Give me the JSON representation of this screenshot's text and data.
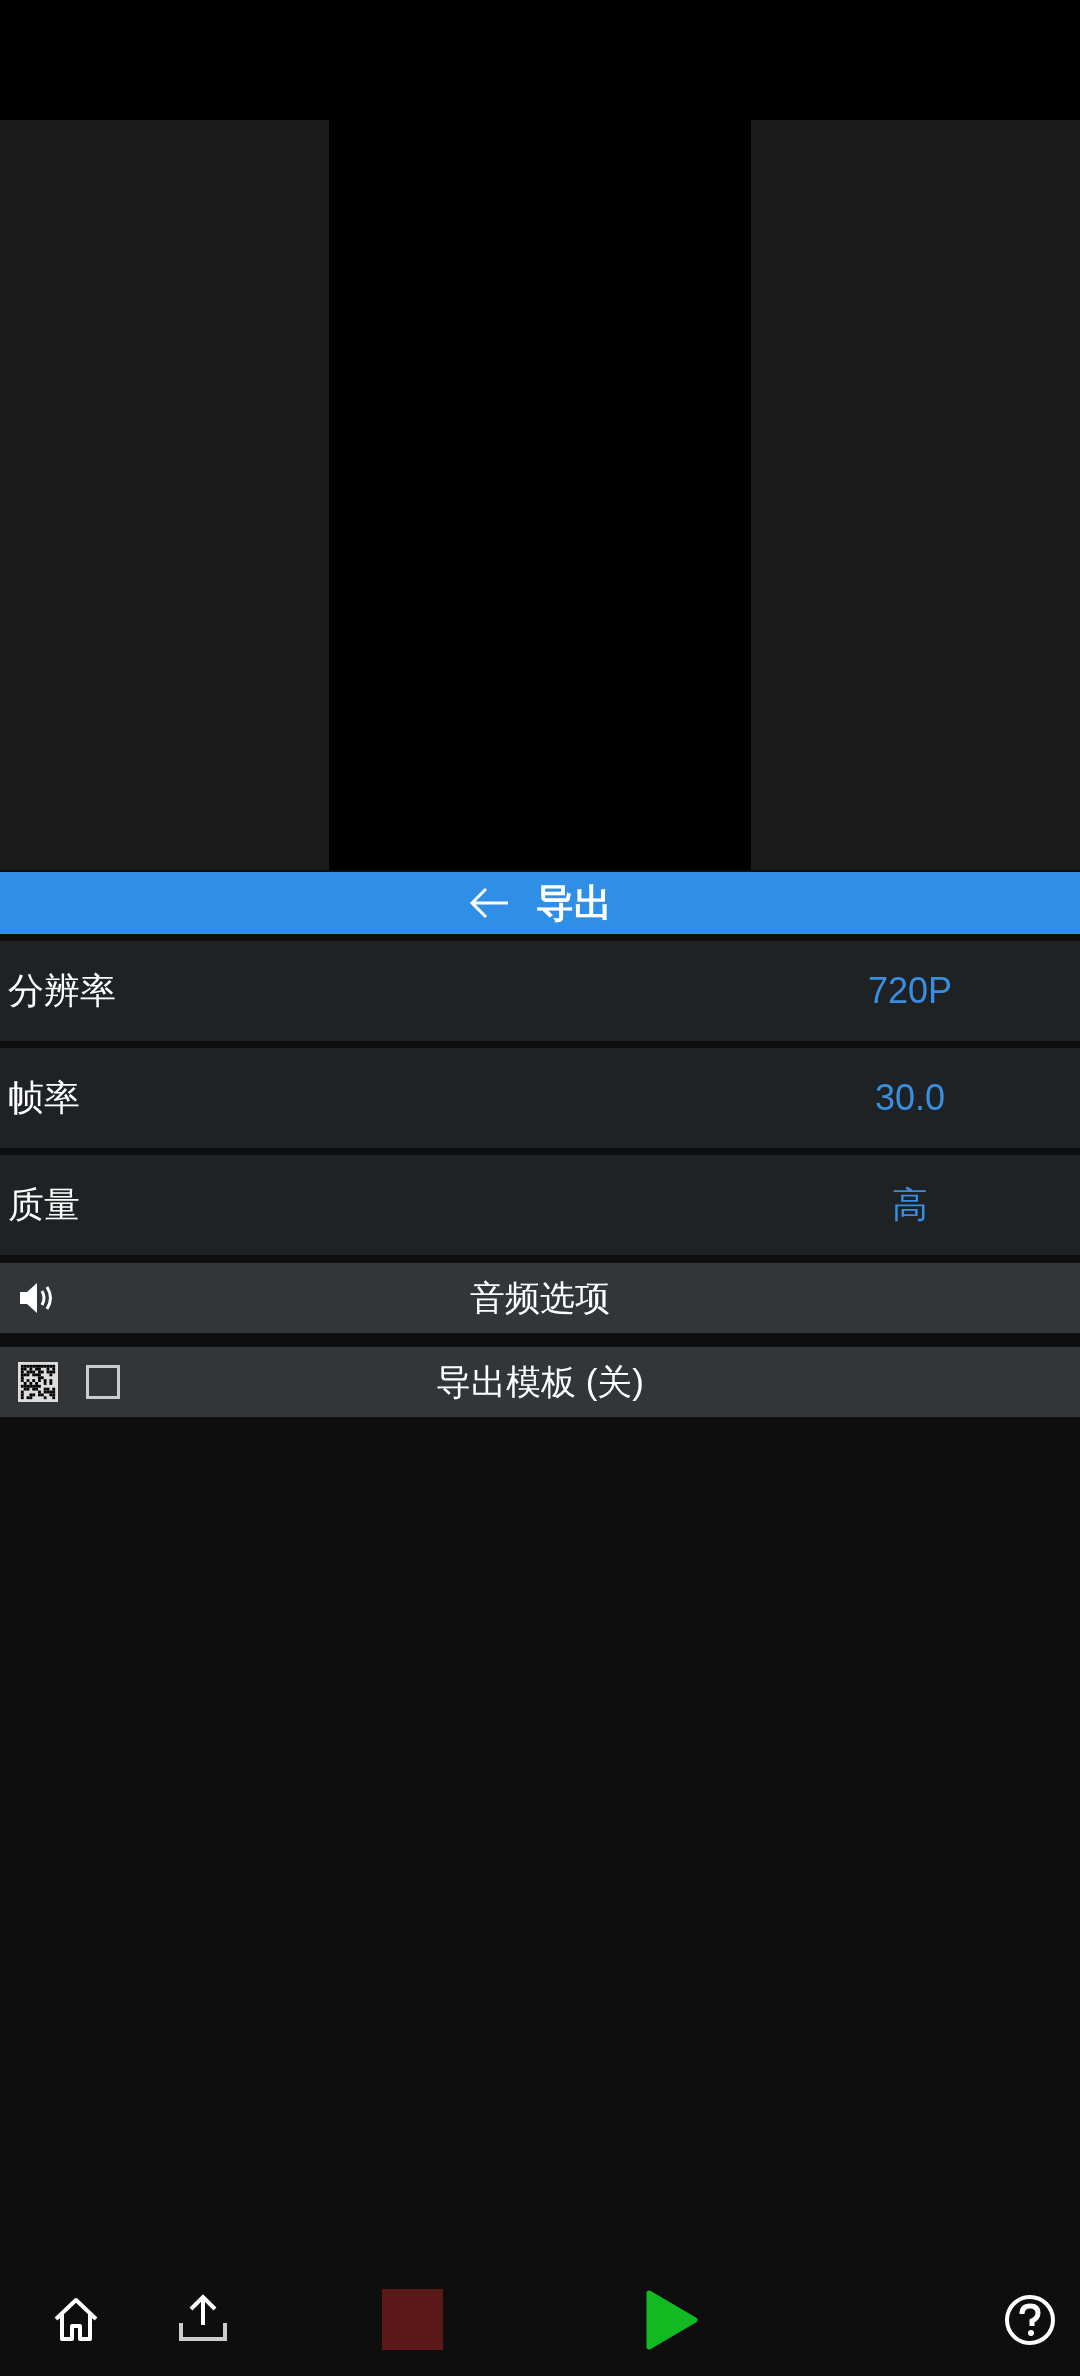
{
  "header": {
    "title": "导出"
  },
  "settings": [
    {
      "label": "分辨率",
      "value": "720P"
    },
    {
      "label": "帧率",
      "value": "30.0"
    },
    {
      "label": "质量",
      "value": "高"
    }
  ],
  "audio_options": {
    "label": "音频选项"
  },
  "export_template": {
    "label": "导出模板 (关)",
    "checked": false
  }
}
